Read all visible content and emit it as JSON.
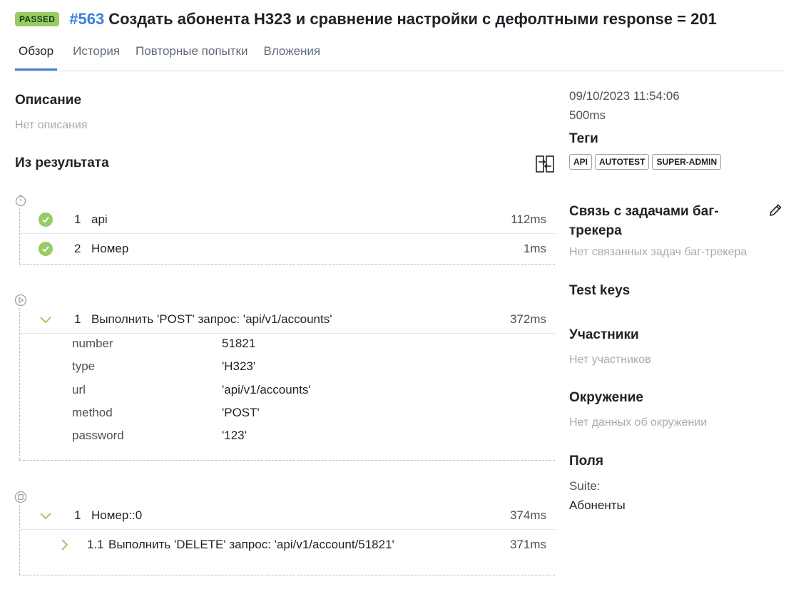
{
  "header": {
    "status_badge": "PASSED",
    "test_id": "#563",
    "title": "Создать абонента H323 и сравнение настройки с дефолтными response = 201"
  },
  "tabs": [
    "Обзор",
    "История",
    "Повторные попытки",
    "Вложения"
  ],
  "description": {
    "heading": "Описание",
    "empty": "Нет описания"
  },
  "result": {
    "heading": "Из результата",
    "setup": [
      {
        "num": "1",
        "name": "api",
        "duration": "112ms"
      },
      {
        "num": "2",
        "name": "Номер",
        "duration": "1ms"
      }
    ],
    "body": {
      "num": "1",
      "name": "Выполнить 'POST' запрос: 'api/v1/accounts'",
      "duration": "372ms",
      "params": [
        {
          "key": "number",
          "value": "51821"
        },
        {
          "key": "type",
          "value": "'H323'"
        },
        {
          "key": "url",
          "value": "'api/v1/accounts'"
        },
        {
          "key": "method",
          "value": "'POST'"
        },
        {
          "key": "password",
          "value": "'123'"
        }
      ]
    },
    "teardown": {
      "num": "1",
      "name": "Номер::0",
      "duration": "374ms",
      "child": {
        "num": "1.1",
        "name": "Выполнить 'DELETE' запрос: 'api/v1/account/51821'",
        "duration": "371ms"
      }
    }
  },
  "sidebar": {
    "datetime": "09/10/2023 11:54:06",
    "duration": "500ms",
    "tags_heading": "Теги",
    "tags": [
      "API",
      "AUTOTEST",
      "SUPER-ADMIN"
    ],
    "bugtracker_heading_1": "Связь с задачами баг-",
    "bugtracker_heading_2": "трекера",
    "bugtracker_empty": "Нет связанных задач баг-трекера",
    "test_keys_heading": "Test keys",
    "participants_heading": "Участники",
    "participants_empty": "Нет участников",
    "environment_heading": "Окружение",
    "environment_empty": "Нет данных об окружении",
    "fields_heading": "Поля",
    "suite_label": "Suite:",
    "suite_value": "Абоненты"
  },
  "colors": {
    "passed": "#97cc64",
    "link": "#3d7fd9",
    "muted": "#a5abb2"
  }
}
